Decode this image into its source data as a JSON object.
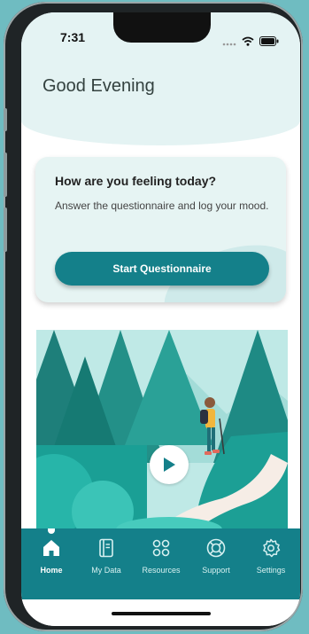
{
  "status": {
    "time": "7:31"
  },
  "header": {
    "greeting": "Good Evening"
  },
  "mood_card": {
    "title": "How are you feeling today?",
    "subtitle": "Answer the questionnaire and log your mood.",
    "button_label": "Start Questionnaire"
  },
  "video": {
    "icon": "play-icon"
  },
  "tabs": [
    {
      "label": "Home",
      "icon": "home-icon",
      "active": true
    },
    {
      "label": "My Data",
      "icon": "notebook-icon",
      "active": false
    },
    {
      "label": "Resources",
      "icon": "grid-icon",
      "active": false
    },
    {
      "label": "Support",
      "icon": "lifebuoy-icon",
      "active": false
    },
    {
      "label": "Settings",
      "icon": "gear-icon",
      "active": false
    }
  ],
  "colors": {
    "brand": "#14808a",
    "header_bg": "#e4f3f3",
    "card_bg": "#e6f4f3",
    "background": "#6fbcc1"
  }
}
